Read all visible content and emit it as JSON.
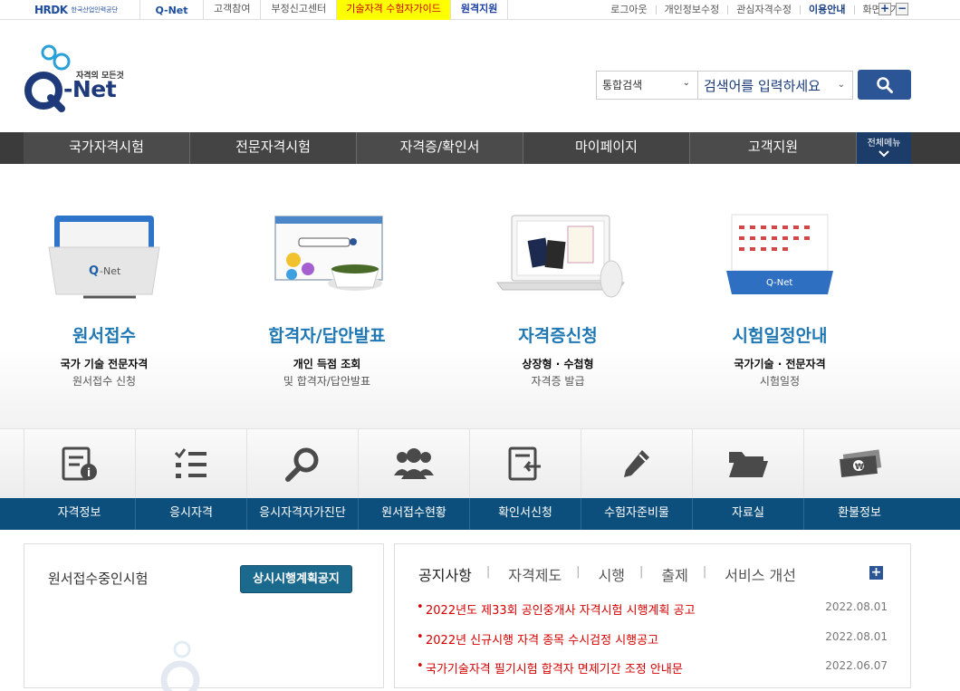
{
  "topbar": {
    "org_name": "HRDK",
    "org_name_kr": "한국산업인력공단",
    "site_name": "Q-Net",
    "links": [
      "고객참여",
      "부정신고센터",
      "기술자격 수험자가이드",
      "원격지원"
    ],
    "right_links": [
      "로그아웃",
      "개인정보수정",
      "관심자격수정",
      "이용안내",
      "화면크기"
    ],
    "zoom_in": "+",
    "zoom_out": "−"
  },
  "logo": {
    "tagline": "자격의 모든것",
    "name": "-Net"
  },
  "search": {
    "scope": "통합검색",
    "placeholder": "검색어를 입력하세요"
  },
  "nav": {
    "items": [
      "국가자격시험",
      "전문자격시험",
      "자격증/확인서",
      "마이페이지",
      "고객지원"
    ],
    "all_menu": "전체메뉴"
  },
  "hero": [
    {
      "title": "원서접수",
      "sub": "국가 기술 전문자격",
      "desc": "원서접수 신청"
    },
    {
      "title": "합격자/답안발표",
      "sub": "개인 득점 조회",
      "desc": "및 합격자/답안발표"
    },
    {
      "title": "자격증신청",
      "sub": "상장형 · 수첩형",
      "desc": "자격증 발급"
    },
    {
      "title": "시험일정안내",
      "sub": "국가기술 · 전문자격",
      "desc": "시험일정"
    }
  ],
  "quick_menu": [
    "자격정보",
    "응시자격",
    "응시자격자가진단",
    "원서접수현황",
    "확인서신청",
    "수험자준비물",
    "자료실",
    "환불정보"
  ],
  "left_panel": {
    "title": "원서접수중인시험",
    "button": "상시시행계획공지"
  },
  "right_panel": {
    "tabs": [
      "공지사항",
      "자격제도",
      "시행",
      "출제",
      "서비스 개선"
    ],
    "more": "+",
    "notices": [
      {
        "title": "2022년도 제33회 공인중개사 자격시험 시행계획 공고",
        "date": "2022.08.01"
      },
      {
        "title": "2022년 신규시행 자격 종목 수시검정 시행공고",
        "date": "2022.08.01"
      },
      {
        "title": "국가기술자격 필기시험 합격자 면제기간 조정 안내문",
        "date": "2022.06.07"
      }
    ]
  },
  "colors": {
    "accent": "#2c5596",
    "nav_bg": "#3b3b3b",
    "label_bar": "#0d4f7c",
    "hero_title": "#1f78b4",
    "notice": "#d40000"
  }
}
